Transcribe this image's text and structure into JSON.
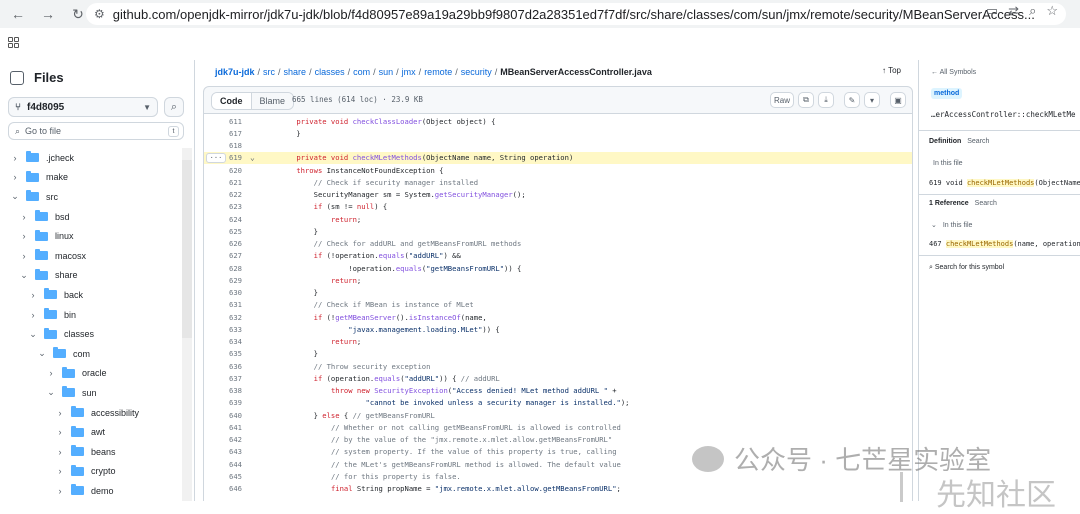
{
  "browser": {
    "url": "github.com/openjdk-mirror/jdk7u-jdk/blob/f4d80957e89a19a29bb9f9807d2a28351ed7f7df/src/share/classes/com/sun/jmx/remote/security/MBeanServerAccess..."
  },
  "sidebar": {
    "title": "Files",
    "branch": "f4d8095",
    "goto_placeholder": "Go to file",
    "goto_key": "t",
    "tree": [
      {
        "label": ".jcheck",
        "depth": 0,
        "open": false
      },
      {
        "label": "make",
        "depth": 0,
        "open": false
      },
      {
        "label": "src",
        "depth": 0,
        "open": true
      },
      {
        "label": "bsd",
        "depth": 1,
        "open": false
      },
      {
        "label": "linux",
        "depth": 1,
        "open": false
      },
      {
        "label": "macosx",
        "depth": 1,
        "open": false
      },
      {
        "label": "share",
        "depth": 1,
        "open": true
      },
      {
        "label": "back",
        "depth": 2,
        "open": false
      },
      {
        "label": "bin",
        "depth": 2,
        "open": false
      },
      {
        "label": "classes",
        "depth": 2,
        "open": true
      },
      {
        "label": "com",
        "depth": 3,
        "open": true
      },
      {
        "label": "oracle",
        "depth": 4,
        "open": false
      },
      {
        "label": "sun",
        "depth": 4,
        "open": true
      },
      {
        "label": "accessibility",
        "depth": 5,
        "open": false
      },
      {
        "label": "awt",
        "depth": 5,
        "open": false
      },
      {
        "label": "beans",
        "depth": 5,
        "open": false
      },
      {
        "label": "crypto",
        "depth": 5,
        "open": false
      },
      {
        "label": "demo",
        "depth": 5,
        "open": false
      }
    ]
  },
  "breadcrumb": {
    "parts": [
      "jdk7u-jdk",
      "src",
      "share",
      "classes",
      "com",
      "sun",
      "jmx",
      "remote",
      "security"
    ],
    "file": "MBeanServerAccessController.java",
    "top_label": "Top"
  },
  "codebar": {
    "tab_code": "Code",
    "tab_blame": "Blame",
    "meta": "665 lines (614 loc) · 23.9 KB",
    "raw_label": "Raw"
  },
  "code_lines": [
    {
      "n": "611",
      "html": "    <span class='kw'>private void</span> <span class='fn'>checkClassLoader</span>(Object object) {"
    },
    {
      "n": "617",
      "html": "    }"
    },
    {
      "n": "618",
      "html": ""
    },
    {
      "n": "619",
      "html": "    <span class='kw'>private void</span> <span class='fn'>checkMLetMethods</span>(ObjectName name, String operation)",
      "hl": true
    },
    {
      "n": "620",
      "html": "    <span class='kw'>throws</span> InstanceNotFoundException {"
    },
    {
      "n": "621",
      "html": "        <span class='cm'>// Check if security manager installed</span>"
    },
    {
      "n": "622",
      "html": "        SecurityManager sm = System.<span class='fn'>getSecurityManager</span>();"
    },
    {
      "n": "623",
      "html": "        <span class='kw'>if</span> (sm != <span class='kw'>null</span>) {"
    },
    {
      "n": "624",
      "html": "            <span class='kw'>return</span>;"
    },
    {
      "n": "625",
      "html": "        }"
    },
    {
      "n": "626",
      "html": "        <span class='cm'>// Check for addURL and getMBeansFromURL methods</span>"
    },
    {
      "n": "627",
      "html": "        <span class='kw'>if</span> (!operation.<span class='fn'>equals</span>(<span class='st'>\"addURL\"</span>) &amp;&amp;"
    },
    {
      "n": "628",
      "html": "                !operation.<span class='fn'>equals</span>(<span class='st'>\"getMBeansFromURL\"</span>)) {"
    },
    {
      "n": "629",
      "html": "            <span class='kw'>return</span>;"
    },
    {
      "n": "630",
      "html": "        }"
    },
    {
      "n": "631",
      "html": "        <span class='cm'>// Check if MBean is instance of MLet</span>"
    },
    {
      "n": "632",
      "html": "        <span class='kw'>if</span> (!<span class='fn'>getMBeanServer</span>().<span class='fn'>isInstanceOf</span>(name,"
    },
    {
      "n": "633",
      "html": "                <span class='st'>\"javax.management.loading.MLet\"</span>)) {"
    },
    {
      "n": "634",
      "html": "            <span class='kw'>return</span>;"
    },
    {
      "n": "635",
      "html": "        }"
    },
    {
      "n": "636",
      "html": "        <span class='cm'>// Throw security exception</span>"
    },
    {
      "n": "637",
      "html": "        <span class='kw'>if</span> (operation.<span class='fn'>equals</span>(<span class='st'>\"addURL\"</span>)) { <span class='cm'>// addURL</span>"
    },
    {
      "n": "638",
      "html": "            <span class='kw'>throw new</span> <span class='fn'>SecurityException</span>(<span class='st'>\"Access denied! MLet method addURL \"</span> +"
    },
    {
      "n": "639",
      "html": "                    <span class='st'>\"cannot be invoked unless a security manager is installed.\"</span>);"
    },
    {
      "n": "640",
      "html": "        } <span class='kw'>else</span> { <span class='cm'>// getMBeansFromURL</span>"
    },
    {
      "n": "641",
      "html": "            <span class='cm'>// Whether or not calling getMBeansFromURL is allowed is controlled</span>"
    },
    {
      "n": "642",
      "html": "            <span class='cm'>// by the value of the \"jmx.remote.x.mlet.allow.getMBeansFromURL\"</span>"
    },
    {
      "n": "643",
      "html": "            <span class='cm'>// system property. If the value of this property is true, calling</span>"
    },
    {
      "n": "644",
      "html": "            <span class='cm'>// the MLet's getMBeansFromURL method is allowed. The default value</span>"
    },
    {
      "n": "645",
      "html": "            <span class='cm'>// for this property is false.</span>"
    },
    {
      "n": "646",
      "html": "            <span class='kw'>final</span> String propName = <span class='st'>\"jmx.remote.x.mlet.allow.getMBeansFromURL\"</span>;"
    }
  ],
  "symbols": {
    "back_label": "All Symbols",
    "kind": "method",
    "name": "…erAccessController::checkMLetMe",
    "definition_label": "Definition",
    "search_label": "Search",
    "in_this_file": "In this file",
    "def_line": "619",
    "def_code_prefix": "void",
    "def_code_highlight": "checkMLetMethods",
    "def_code_suffix": "(ObjectName",
    "references_label": "1 Reference",
    "ref_in_this_file": "In this file",
    "ref_line": "467",
    "ref_code_highlight": "checkMLetMethods",
    "ref_code_suffix": "(name, operationN",
    "search_symbol": "Search for this symbol"
  },
  "watermark": {
    "line1": "公众号 · 七芒星实验室",
    "line2": "先知社区"
  }
}
